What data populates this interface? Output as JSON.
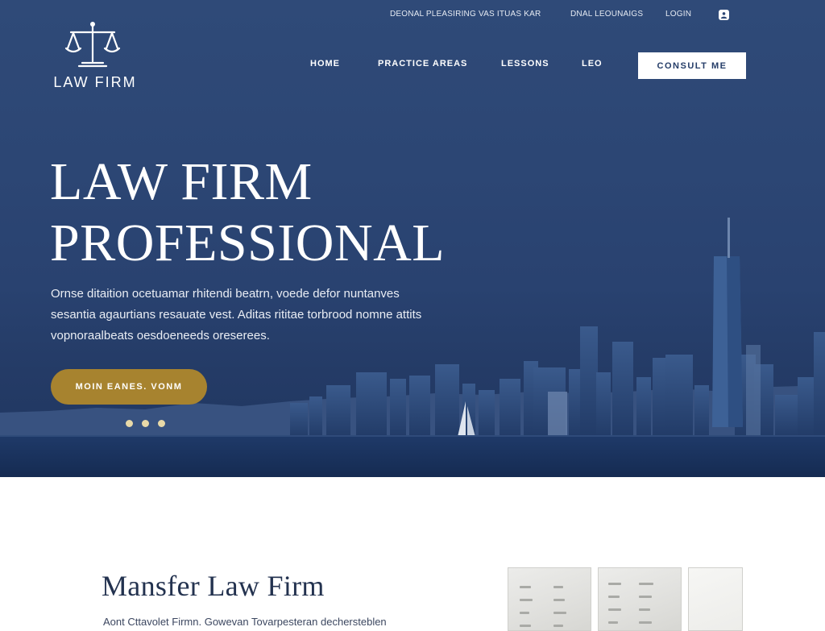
{
  "topbar": {
    "contact": "DEONAL PLEASIRING",
    "hours": "VAS ITUAS KAR",
    "address": "DNAL LEOUNAIGS",
    "login": "LOGIN"
  },
  "logo": {
    "text": "LAW FIRM",
    "icon": "scales-of-justice-icon"
  },
  "nav": {
    "items": [
      "HOME",
      "PRACTICE AREAS",
      "LESSONS",
      "LEO"
    ],
    "cta": "CONSULT ME"
  },
  "hero": {
    "headline_line1": "LAW FIRM",
    "headline_line2": "PROFESSIONAL",
    "lead": "Ornse ditaition ocetuamar rhitendi beatrn, voede defor nuntanves sesantia agaurtians resauate vest. Aditas rititae torbrood nomne attits vopnoraalbeats oesdoeneeds oreserees.",
    "cta": "MOIN EANES. VONM",
    "slide_count": 3
  },
  "about": {
    "title": "Mansfer Law Firm",
    "subtitle": "Aont Cttavolet Firmn. Gowevan Tovarpesteran dechersteblen"
  },
  "colors": {
    "hero_bg": "#2c4674",
    "accent_gold": "#a7832f",
    "dot_color": "#e8d9a8",
    "heading_dark": "#23324f"
  }
}
